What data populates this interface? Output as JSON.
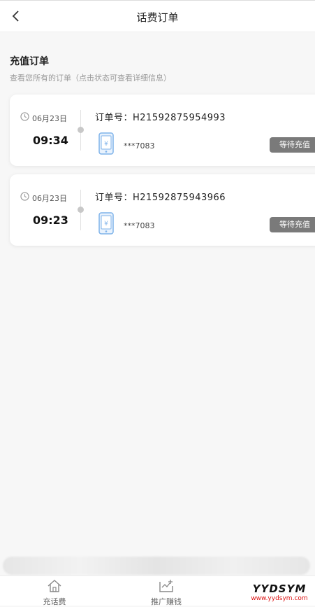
{
  "nav": {
    "title": "话费订单",
    "back_icon": "chevron-left-icon"
  },
  "section": {
    "title": "充值订单",
    "subtitle": "查看您所有的订单（点击状态可查看详细信息）"
  },
  "orders": [
    {
      "date": "06月23日",
      "time": "09:34",
      "order_no": "订单号：H21592875954993",
      "phone": "***7083",
      "status": "等待充值"
    },
    {
      "date": "06月23日",
      "time": "09:23",
      "order_no": "订单号：H21592875943966",
      "phone": "***7083",
      "status": "等待充值"
    }
  ],
  "tabbar": {
    "items": [
      {
        "label": "充话费",
        "icon": "home-icon"
      },
      {
        "label": "推广赚钱",
        "icon": "share-icon"
      }
    ]
  },
  "watermark": {
    "title": "YYDSYM",
    "url": "www.yydsym.com"
  },
  "colors": {
    "status_bg": "#7a7a7a",
    "phone_icon": "#7fb3ea"
  }
}
